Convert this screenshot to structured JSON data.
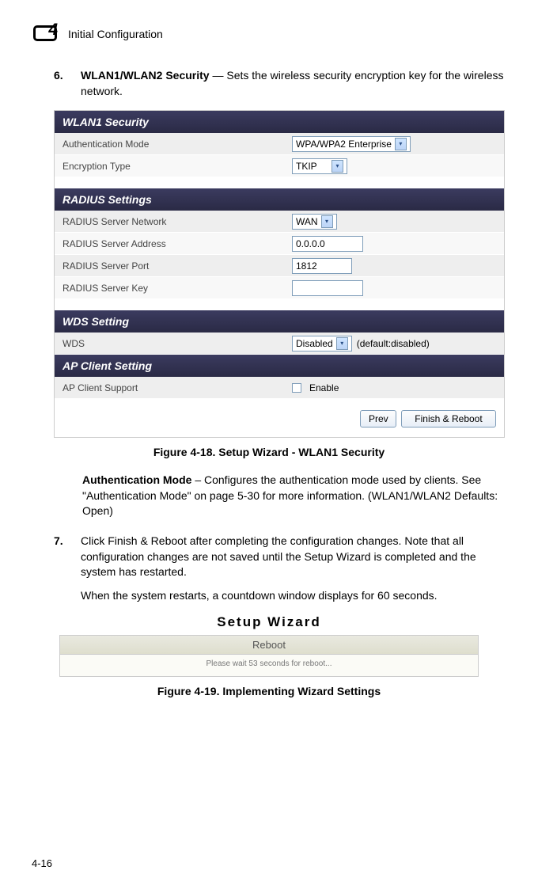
{
  "chapter_number": "4",
  "chapter_title": "Initial Configuration",
  "step6": {
    "num": "6.",
    "title": "WLAN1/WLAN2 Security",
    "desc": " — Sets the wireless security encryption key for the wireless network."
  },
  "fig418": {
    "wlan1_security": "WLAN1 Security",
    "auth_mode_label": "Authentication Mode",
    "auth_mode_value": "WPA/WPA2 Enterprise",
    "enc_type_label": "Encryption Type",
    "enc_type_value": "TKIP",
    "radius_settings": "RADIUS Settings",
    "r_network_label": "RADIUS Server Network",
    "r_network_value": "WAN",
    "r_addr_label": "RADIUS Server Address",
    "r_addr_value": "0.0.0.0",
    "r_port_label": "RADIUS Server Port",
    "r_port_value": "1812",
    "r_key_label": "RADIUS Server Key",
    "r_key_value": "",
    "wds_setting": "WDS Setting",
    "wds_label": "WDS",
    "wds_value": "Disabled",
    "wds_default": "(default:disabled)",
    "apc_setting": "AP Client Setting",
    "apc_label": "AP Client Support",
    "apc_enable": "Enable",
    "btn_prev": "Prev",
    "btn_finish": "Finish & Reboot"
  },
  "caption418": "Figure 4-18.   Setup Wizard - WLAN1 Security",
  "auth_para": {
    "title": "Authentication Mode",
    "body": " – Configures the authentication mode used by clients. See \"Authentication Mode\" on page 5-30 for more information. (WLAN1/WLAN2 Defaults: Open)"
  },
  "step7": {
    "num": "7.",
    "body1": "Click Finish & Reboot after completing the configuration changes. Note that all configuration changes are not saved until the Setup Wizard is completed and the system has restarted.",
    "body2": "When the system restarts, a countdown window displays for 60 seconds."
  },
  "fig419": {
    "title": "Setup Wizard",
    "tab": "Reboot",
    "msg": "Please wait  53  seconds for reboot..."
  },
  "caption419": "Figure 4-19.   Implementing Wizard Settings",
  "page_number": "4-16"
}
